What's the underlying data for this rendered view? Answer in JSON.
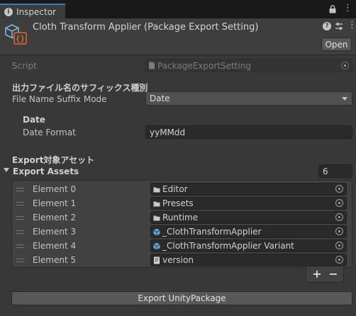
{
  "tab": {
    "icon": "info-icon",
    "label": "Inspector"
  },
  "header": {
    "title": "Cloth Transform Applier (Package Export Setting)",
    "open_label": "Open",
    "icons": [
      "script-asset-icon",
      "help-icon",
      "settings-icon",
      "menu-icon"
    ]
  },
  "script": {
    "label": "Script",
    "value": "PackageExportSetting"
  },
  "suffix": {
    "heading": "出力ファイル名のサフィックス種別",
    "label": "File Name Suffix Mode",
    "value": "Date"
  },
  "date": {
    "heading": "Date",
    "format_label": "Date Format",
    "format_value": "yyMMdd"
  },
  "assets": {
    "heading": "Export対象アセット",
    "label": "Export Assets",
    "size": "6",
    "elements": [
      {
        "label": "Element 0",
        "value": "Editor",
        "icon": "folder-icon"
      },
      {
        "label": "Element 1",
        "value": "Presets",
        "icon": "folder-icon"
      },
      {
        "label": "Element 2",
        "value": "Runtime",
        "icon": "folder-icon"
      },
      {
        "label": "Element 3",
        "value": "_ClothTransformApplier",
        "icon": "prefab-icon"
      },
      {
        "label": "Element 4",
        "value": "_ClothTransformApplier Variant",
        "icon": "prefab-icon"
      },
      {
        "label": "Element 5",
        "value": "version",
        "icon": "text-asset-icon"
      }
    ],
    "add_label": "+",
    "remove_label": "−"
  },
  "export_button_label": "Export UnityPackage",
  "colors": {
    "background": "#383838",
    "tab_accent": "#3a79bb",
    "prefab_blue": "#5aa8e0"
  }
}
